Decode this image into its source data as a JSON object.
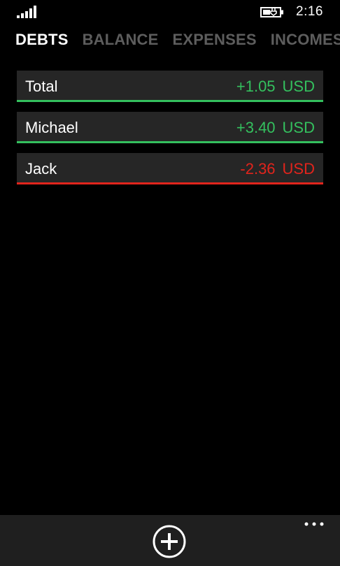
{
  "status_bar": {
    "signal_icon": "signal-strength-icon",
    "battery_icon": "battery-charging-icon",
    "time": "2:16"
  },
  "pivot": {
    "tabs": [
      {
        "label": "DEBTS",
        "active": true
      },
      {
        "label": "BALANCE",
        "active": false
      },
      {
        "label": "EXPENSES",
        "active": false
      },
      {
        "label": "INCOMES",
        "active": false
      }
    ]
  },
  "debts": [
    {
      "name": "Total",
      "amount": "+1.05",
      "currency": "USD",
      "status": "positive"
    },
    {
      "name": "Michael",
      "amount": "+3.40",
      "currency": "USD",
      "status": "positive"
    },
    {
      "name": "Jack",
      "amount": "-2.36",
      "currency": "USD",
      "status": "negative"
    }
  ],
  "app_bar": {
    "add_icon": "add-circle-icon",
    "more_icon": "ellipsis-icon"
  },
  "colors": {
    "positive": "#34c05e",
    "negative": "#e1241c",
    "inactive_tab": "#5d5d5d",
    "row_background": "#262626",
    "app_bar_background": "#1f1f1f"
  }
}
